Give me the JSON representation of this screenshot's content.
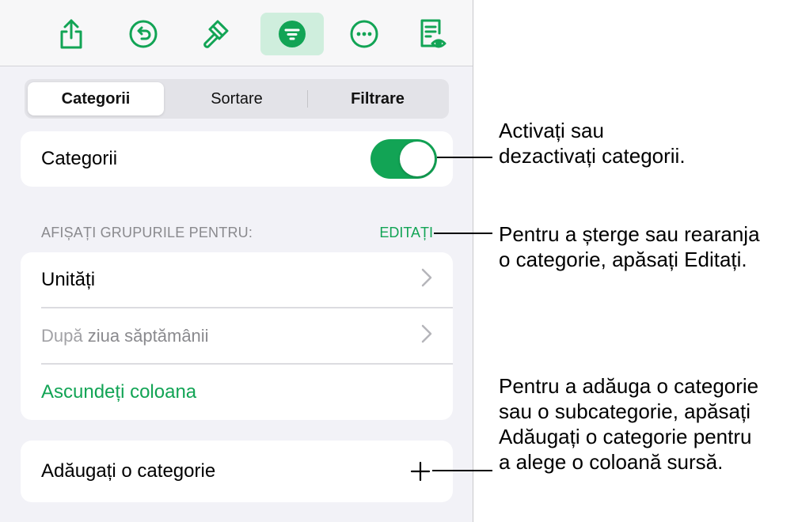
{
  "tabs": [
    "Categorii",
    "Sortare",
    "Filtrare"
  ],
  "categories_toggle": {
    "label": "Categorii",
    "on": true
  },
  "section": {
    "label": "AFIȘAȚI GRUPURILE PENTRU:",
    "edit": "EDITAȚI"
  },
  "groups": {
    "first": "Unități",
    "second_prefix": "După",
    "second_rest": " ziua săptămânii",
    "hide_column": "Ascundeți coloana"
  },
  "add_category": "Adăugați o categorie",
  "callouts": {
    "toggle": [
      "Activați sau",
      "dezactivați categorii."
    ],
    "edit": [
      "Pentru a șterge sau rearanja",
      "o categorie, apăsați Editați."
    ],
    "add": [
      "Pentru a adăuga o categorie",
      "sau o subcategorie, apăsați",
      "Adăugați o categorie pentru",
      "a alege o coloană sursă."
    ]
  },
  "icons": [
    "share-icon",
    "undo-icon",
    "paintbrush-icon",
    "organize-icon",
    "more-icon",
    "reader-icon"
  ],
  "colors": {
    "accent": "#12a455",
    "accent_bg": "#cfeedd",
    "panel_bg": "#f2f2f7"
  }
}
